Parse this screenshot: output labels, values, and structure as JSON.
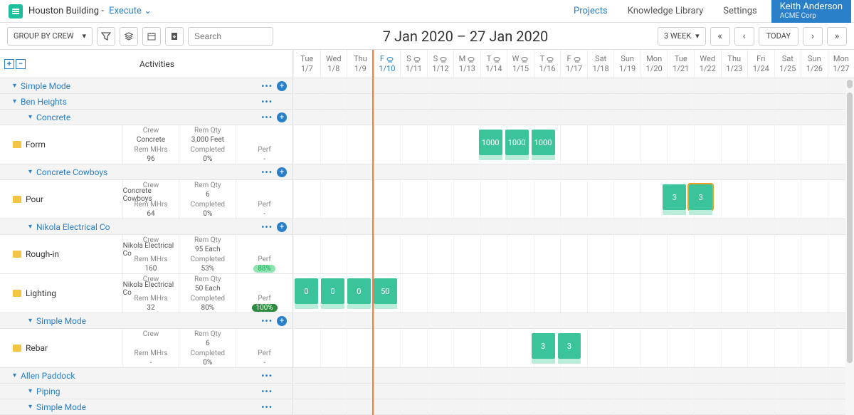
{
  "header": {
    "project": "Houston Building",
    "stage": "Execute",
    "nav": {
      "projects": "Projects",
      "library": "Knowledge Library",
      "settings": "Settings"
    },
    "user": {
      "name": "Keith Anderson",
      "company": "ACME Corp"
    }
  },
  "toolbar": {
    "group_label": "GROUP BY CREW",
    "search_placeholder": "Search",
    "date_range": "7 Jan 2020 – 27 Jan 2020",
    "timescale": "3 WEEK",
    "today": "TODAY"
  },
  "columns_header": "Activities",
  "days": [
    {
      "dow": "Tue",
      "date": "1/7",
      "weather": false
    },
    {
      "dow": "Wed",
      "date": "1/8",
      "weather": false
    },
    {
      "dow": "Thu",
      "date": "1/9",
      "weather": false
    },
    {
      "dow": "F",
      "date": "1/10",
      "weather": true,
      "today": true
    },
    {
      "dow": "S",
      "date": "1/11",
      "weather": true
    },
    {
      "dow": "S",
      "date": "1/12",
      "weather": true
    },
    {
      "dow": "M",
      "date": "1/13",
      "weather": true
    },
    {
      "dow": "T",
      "date": "1/14",
      "weather": true
    },
    {
      "dow": "W",
      "date": "1/15",
      "weather": true
    },
    {
      "dow": "T",
      "date": "1/16",
      "weather": true
    },
    {
      "dow": "F",
      "date": "1/17",
      "weather": true
    },
    {
      "dow": "Sat",
      "date": "1/18",
      "weather": false
    },
    {
      "dow": "Sun",
      "date": "1/19",
      "weather": false
    },
    {
      "dow": "Mon",
      "date": "1/20",
      "weather": false
    },
    {
      "dow": "Tue",
      "date": "1/21",
      "weather": false
    },
    {
      "dow": "Wed",
      "date": "1/22",
      "weather": false
    },
    {
      "dow": "Thu",
      "date": "1/23",
      "weather": false
    },
    {
      "dow": "Fri",
      "date": "1/24",
      "weather": false
    },
    {
      "dow": "Sat",
      "date": "1/25",
      "weather": false
    },
    {
      "dow": "Sun",
      "date": "1/26",
      "weather": false
    },
    {
      "dow": "Mon",
      "date": "1/27",
      "weather": false
    }
  ],
  "groups": {
    "simple_mode": "Simple Mode",
    "ben_heights": "Ben Heights",
    "concrete": "Concrete",
    "concrete_cowboys": "Concrete Cowboys",
    "nikola": "Nikola Electrical Co",
    "simple_mode2": "Simple Mode",
    "allen": "Allen Paddock",
    "piping": "Piping",
    "simple_mode3": "Simple Mode"
  },
  "meta_labels": {
    "crew": "Crew",
    "rem_qty": "Rem Qty",
    "rem_mhrs": "Rem MHrs",
    "completed": "Completed",
    "perf": "Perf"
  },
  "activities": {
    "form": {
      "name": "Form",
      "crew": "Concrete",
      "rem_qty": "3,000 Feet",
      "rem_mhrs": "96",
      "completed": "0%",
      "perf": "-"
    },
    "pour": {
      "name": "Pour",
      "crew": "Concrete Cowboys",
      "rem_qty": "6",
      "rem_mhrs": "64",
      "completed": "0%",
      "perf": "-"
    },
    "rough": {
      "name": "Rough-in",
      "crew": "Nikola Electrical Co",
      "rem_qty": "95 Each",
      "rem_mhrs": "160",
      "completed": "53%",
      "perf": "88%"
    },
    "light": {
      "name": "Lighting",
      "crew": "Nikola Electrical Co",
      "rem_qty": "50 Each",
      "rem_mhrs": "32",
      "completed": "80%",
      "perf": "100%"
    },
    "rebar": {
      "name": "Rebar",
      "crew": "",
      "rem_qty": "6",
      "rem_mhrs": "-",
      "completed": "0%",
      "perf": "-"
    }
  },
  "bars": {
    "form": [
      {
        "day": 7,
        "val": "1000"
      },
      {
        "day": 8,
        "val": "1000"
      },
      {
        "day": 9,
        "val": "1000"
      }
    ],
    "pour": [
      {
        "day": 14,
        "val": "3"
      },
      {
        "day": 15,
        "val": "3",
        "sel": true
      }
    ],
    "light": [
      {
        "day": 0,
        "val": "0"
      },
      {
        "day": 1,
        "val": "0"
      },
      {
        "day": 2,
        "val": "0"
      },
      {
        "day": 3,
        "val": "50"
      }
    ],
    "rebar": [
      {
        "day": 9,
        "val": "3"
      },
      {
        "day": 10,
        "val": "3"
      }
    ]
  }
}
